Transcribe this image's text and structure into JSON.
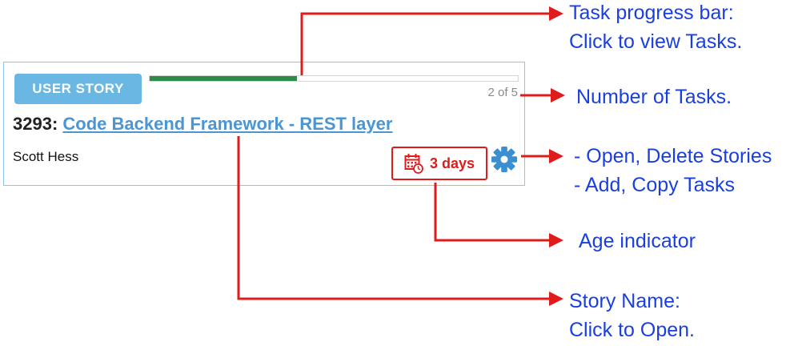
{
  "card": {
    "badge": "USER STORY",
    "progress": {
      "completed": 2,
      "total": 5,
      "fraction": 0.4,
      "label": "2 of 5"
    },
    "story_id": "3293:",
    "story_name": "Code Backend Framework - REST layer",
    "owner": "Scott Hess",
    "age": "3 days",
    "icons": {
      "age": "calendar-clock-icon",
      "menu": "gear-icon"
    }
  },
  "annotations": {
    "progress_bar": {
      "line1": "Task progress bar:",
      "line2": "Click to view Tasks."
    },
    "task_count": "Number of Tasks.",
    "gear_menu": {
      "line1": "- Open, Delete Stories",
      "line2": "- Add, Copy Tasks"
    },
    "age_indicator": "Age indicator",
    "story_name": {
      "line1": "Story Name:",
      "line2": "Click to Open."
    }
  },
  "colors": {
    "badge": "#6ab7e3",
    "progress_fill": "#2e8b4a",
    "link": "#4a95d3",
    "alert": "#e01b1b",
    "callout_text": "#1a3fe0",
    "card_border": "#8ec4ea"
  }
}
